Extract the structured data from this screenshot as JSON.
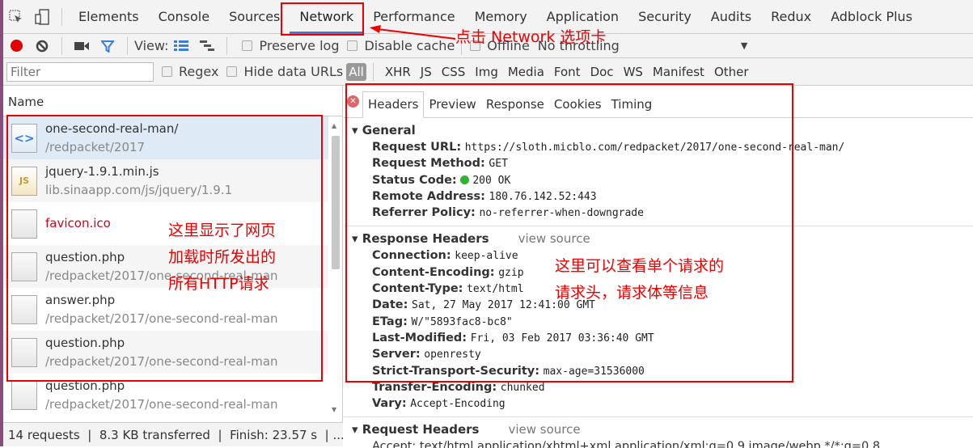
{
  "tabs": [
    "Elements",
    "Console",
    "Sources",
    "Network",
    "Performance",
    "Memory",
    "Application",
    "Security",
    "Audits",
    "Redux",
    "Adblock Plus"
  ],
  "active_tab": "Network",
  "toolbar": {
    "view_label": "View:",
    "preserve_log": "Preserve log",
    "disable_cache": "Disable cache",
    "offline": "Offline",
    "throttling": "No throttling",
    "record_color": "#e00000",
    "filter_color": "#3b7ddd"
  },
  "filters": {
    "placeholder": "Filter",
    "regex": "Regex",
    "hide_data_urls": "Hide data URLs",
    "types": [
      "All",
      "XHR",
      "JS",
      "CSS",
      "Img",
      "Media",
      "Font",
      "Doc",
      "WS",
      "Manifest",
      "Other"
    ]
  },
  "list": {
    "header": "Name",
    "rows": [
      {
        "name": "one-second-real-man/",
        "sub": "/redpacket/2017",
        "icon": "html-doc-icon"
      },
      {
        "name": "jquery-1.9.1.min.js",
        "sub": "lib.sinaapp.com/js/jquery/1.9.1",
        "icon": "js-file-icon"
      },
      {
        "name": "favicon.ico",
        "sub": "",
        "icon": "file-icon",
        "error": true
      },
      {
        "name": "question.php",
        "sub": "/redpacket/2017/one-second-real-man",
        "icon": "file-icon"
      },
      {
        "name": "answer.php",
        "sub": "/redpacket/2017/one-second-real-man",
        "icon": "file-icon"
      },
      {
        "name": "question.php",
        "sub": "/redpacket/2017/one-second-real-man",
        "icon": "file-icon"
      },
      {
        "name": "question.php",
        "sub": "/redpacket/2017/one-second-real-man",
        "icon": "file-icon"
      }
    ]
  },
  "status": {
    "requests": "14 requests",
    "transferred": "8.3 KB transferred",
    "finish": "Finish: 23.57 s",
    "more": "..."
  },
  "detail": {
    "tabs": [
      "Headers",
      "Preview",
      "Response",
      "Cookies",
      "Timing"
    ],
    "active": "Headers",
    "general": {
      "title": "General",
      "items": [
        {
          "k": "Request URL:",
          "v": "https://sloth.micblo.com/redpacket/2017/one-second-real-man/"
        },
        {
          "k": "Request Method:",
          "v": "GET"
        },
        {
          "k": "Status Code:",
          "v": "200 OK"
        },
        {
          "k": "Remote Address:",
          "v": "180.76.142.52:443"
        },
        {
          "k": "Referrer Policy:",
          "v": "no-referrer-when-downgrade"
        }
      ]
    },
    "response": {
      "title": "Response Headers",
      "view_source": "view source",
      "items": [
        {
          "k": "Connection:",
          "v": "keep-alive"
        },
        {
          "k": "Content-Encoding:",
          "v": "gzip"
        },
        {
          "k": "Content-Type:",
          "v": "text/html"
        },
        {
          "k": "Date:",
          "v": "Sat, 27 May 2017 12:41:00 GMT"
        },
        {
          "k": "ETag:",
          "v": "W/\"5893fac8-bc8\""
        },
        {
          "k": "Last-Modified:",
          "v": "Fri, 03 Feb 2017 03:36:40 GMT"
        },
        {
          "k": "Server:",
          "v": "openresty"
        },
        {
          "k": "Strict-Transport-Security:",
          "v": "max-age=31536000"
        },
        {
          "k": "Transfer-Encoding:",
          "v": "chunked"
        },
        {
          "k": "Vary:",
          "v": "Accept-Encoding"
        }
      ]
    },
    "request": {
      "title": "Request Headers",
      "view_source": "view source",
      "partial": "Accept: text/html,application/xhtml+xml,application/xml;q=0.9,image/webp,*/*;q=0.8"
    }
  },
  "annotations": {
    "network_tab": "点击 Network 选项卡",
    "list": [
      "这里显示了网页",
      "加载时所发出的",
      "所有HTTP请求"
    ],
    "detail": [
      "这里可以查看单个请求的",
      "请求头，请求体等信息"
    ],
    "color": "#e00000"
  }
}
